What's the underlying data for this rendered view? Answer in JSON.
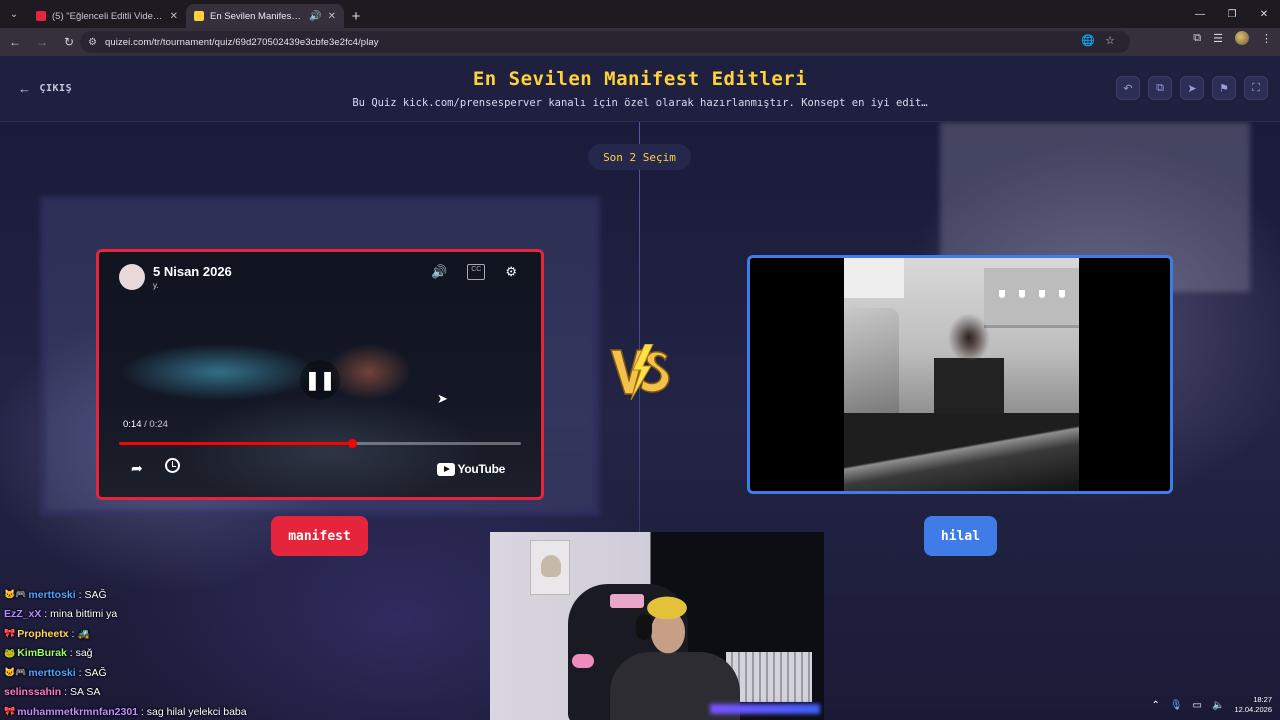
{
  "browser": {
    "tabs": [
      {
        "title": "(5) \"Eğlenceli Editli Video\" Kick",
        "active": false
      },
      {
        "title": "En Sevilen Manifest Editleri",
        "active": true
      }
    ],
    "url": "quizei.com/tr/tournament/quiz/69d270502439e3cbfe3e2fc4/play"
  },
  "quiz": {
    "exit_label": "ÇIKIŞ",
    "title": "En Sevilen Manifest Editleri",
    "subtitle": "Bu Quiz kick.com/prensesperver kanalı için özel olarak hazırlanmıştır. Konsept en iyi edit…",
    "round_label": "Son 2 Seçim",
    "header_buttons": [
      "undo-icon",
      "copy-icon",
      "send-icon",
      "flag-icon",
      "fullscreen-icon"
    ],
    "accent": "#ffd23a",
    "left_color": "#e5253b",
    "right_color": "#3f7ce8",
    "left": {
      "video_title": "5 Nisan 2026",
      "channel_sub": "y.",
      "current_time": "0:14",
      "duration": "0:24",
      "progress": 0.58,
      "yt_brand": "YouTube",
      "vote_label": "manifest"
    },
    "right": {
      "vote_label": "hilal"
    }
  },
  "chat": [
    {
      "badges": "🐱🎮",
      "user": "merttoski",
      "user_color": "#4ea3ff",
      "msg": "SAĞ"
    },
    {
      "badges": "",
      "user": "EzZ_xX",
      "user_color": "#b48cff",
      "msg": "mina bittimi ya"
    },
    {
      "badges": "🎀",
      "user": "Propheetx",
      "user_color": "#ffd95a",
      "msg": "🚜"
    },
    {
      "badges": "🐸",
      "user": "KimBurak",
      "user_color": "#9cff6a",
      "msg": "sağ"
    },
    {
      "badges": "🐱🎮",
      "user": "merttoski",
      "user_color": "#4ea3ff",
      "msg": "SAĞ"
    },
    {
      "badges": "",
      "user": "selinssahin",
      "user_color": "#ff77c8",
      "msg": "SA SA"
    },
    {
      "badges": "🎀",
      "user": "muhammetkrmnfan2301",
      "user_color": "#c28cff",
      "msg": "sag hilal yelekci baba"
    }
  ],
  "system": {
    "time": "18:27",
    "date": "12.04.2026"
  }
}
